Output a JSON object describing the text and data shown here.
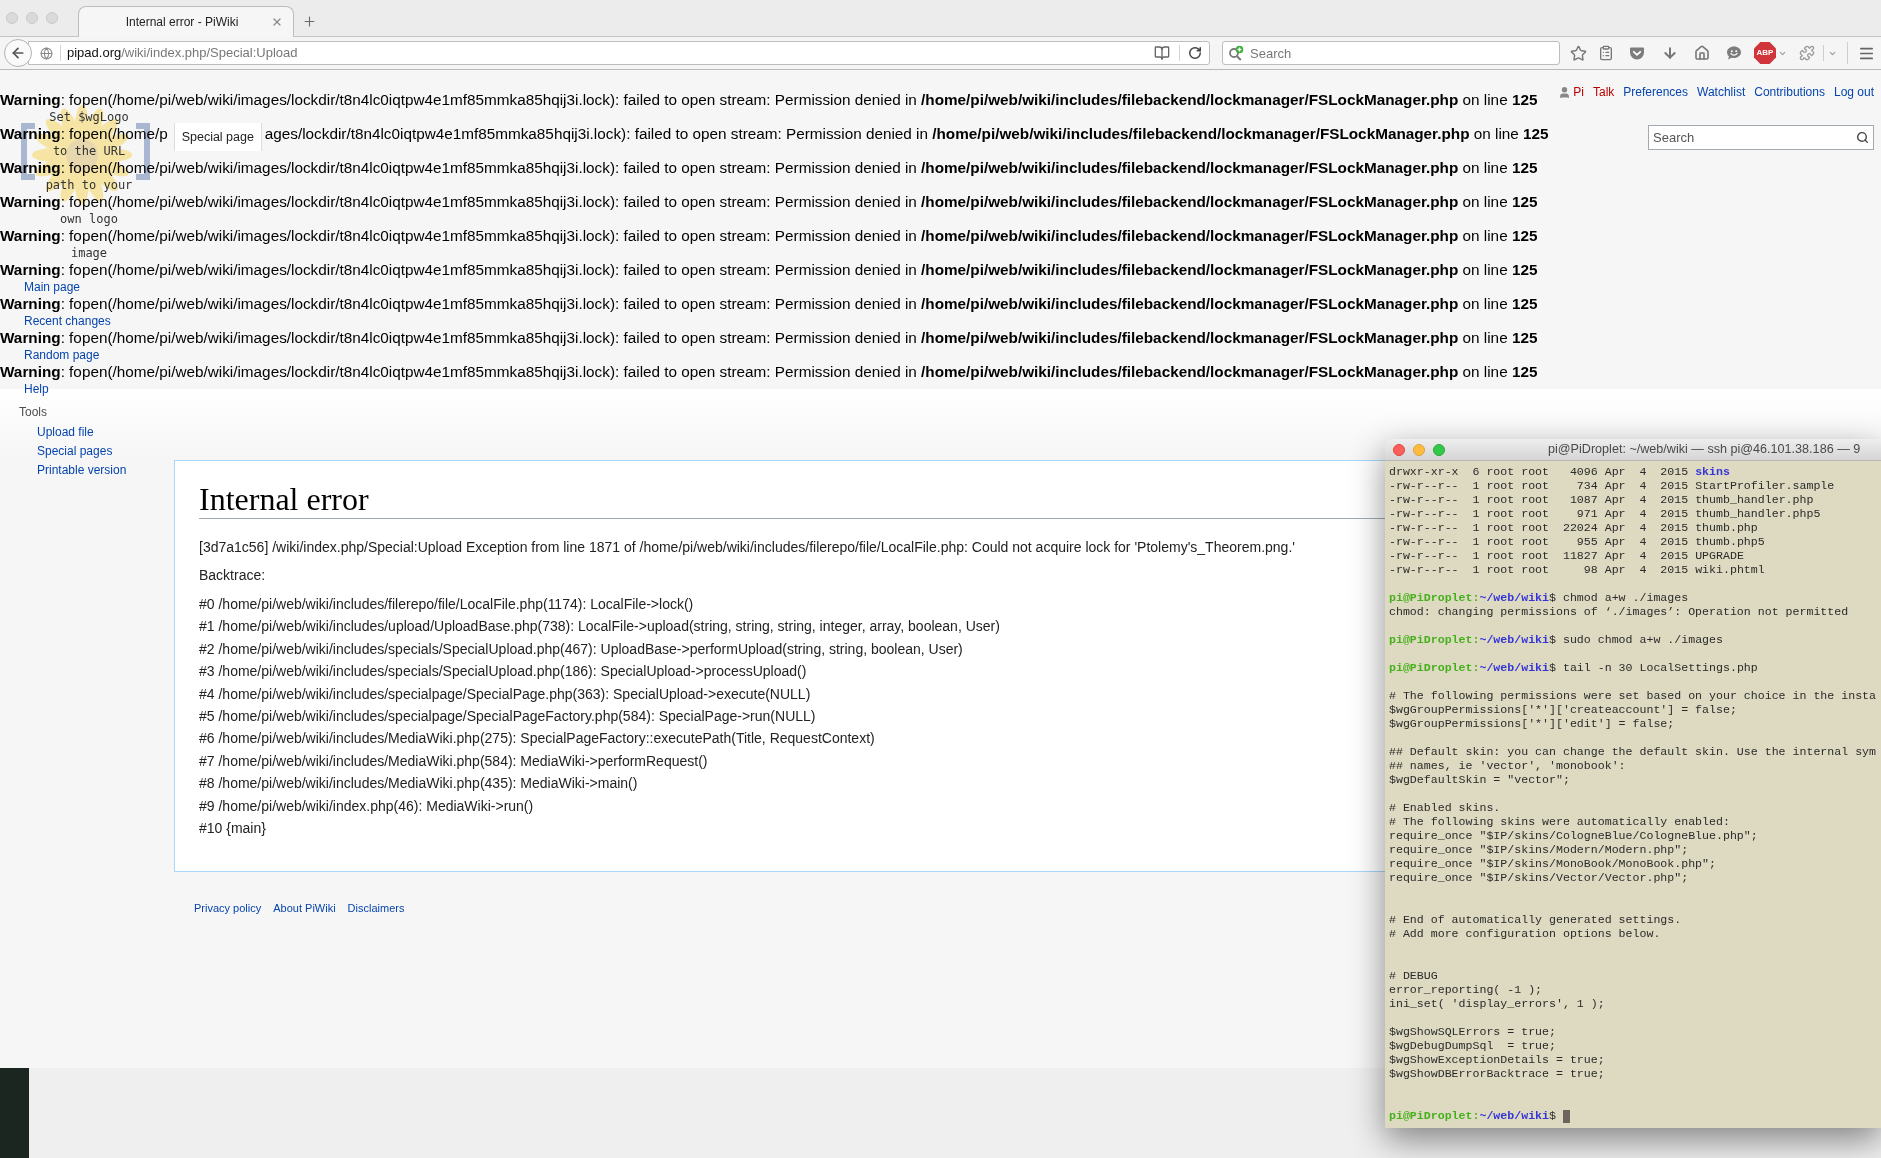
{
  "browser": {
    "tabs": [
      {
        "title": "Internal error - PiWiki",
        "selected": true
      }
    ],
    "url": {
      "domain": "pipad.org",
      "path": "/wiki/index.php/Special:Upload"
    },
    "search": {
      "placeholder": "Search"
    },
    "adblock_label": "ABP"
  },
  "warnings": [
    {
      "parts": [
        "**Warning**: fopen(/home/pi/web/wiki/images/lockdir/t8n4lc0iqtpw4e1mf85mmka85hqij3i.lock): failed to open stream: Permission denied in **/home/pi/web/wiki/includes/filebackend/lockmanager/FSLockManager.php** on line **125**"
      ]
    },
    {
      "parts": [
        "**Warning**: fopen(/home/p",
        "ages/lockdir/t8n4lc0iqtpw4e1mf85mmka85hqij3i.lock): failed to open stream: Permission denied in **/home/pi/web/wiki/includes/filebackend/lockmanager/FSLockManager.php** on line **125**"
      ]
    },
    {
      "parts": [
        "**Warning**: fopen(/home/pi/web/wiki/images/lockdir/t8n4lc0iqtpw4e1mf85mmka85hqij3i.lock): failed to open stream: Permission denied in **/home/pi/web/wiki/includes/filebackend/lockmanager/FSLockManager.php** on line **125**"
      ]
    },
    {
      "parts": [
        "**Warning**: fopen(/home/pi/web/wiki/images/lockdir/t8n4lc0iqtpw4e1mf85mmka85hqij3i.lock): failed to open stream: Permission denied in **/home/pi/web/wiki/includes/filebackend/lockmanager/FSLockManager.php** on line **125**"
      ]
    },
    {
      "parts": [
        "**Warning**: fopen(/home/pi/web/wiki/images/lockdir/t8n4lc0iqtpw4e1mf85mmka85hqij3i.lock): failed to open stream: Permission denied in **/home/pi/web/wiki/includes/filebackend/lockmanager/FSLockManager.php** on line **125**"
      ]
    },
    {
      "parts": [
        "**Warning**: fopen(/home/pi/web/wiki/images/lockdir/t8n4lc0iqtpw4e1mf85mmka85hqij3i.lock): failed to open stream: Permission denied in **/home/pi/web/wiki/includes/filebackend/lockmanager/FSLockManager.php** on line **125**"
      ]
    },
    {
      "parts": [
        "**Warning**: fopen(/home/pi/web/wiki/images/lockdir/t8n4lc0iqtpw4e1mf85mmka85hqij3i.lock): failed to open stream: Permission denied in **/home/pi/web/wiki/includes/filebackend/lockmanager/FSLockManager.php** on line **125**"
      ]
    },
    {
      "parts": [
        "**Warning**: fopen(/home/pi/web/wiki/images/lockdir/t8n4lc0iqtpw4e1mf85mmka85hqij3i.lock): failed to open stream: Permission denied in **/home/pi/web/wiki/includes/filebackend/lockmanager/FSLockManager.php** on line **125**"
      ]
    },
    {
      "parts": [
        "**Warning**: fopen(/home/pi/web/wiki/images/lockdir/t8n4lc0iqtpw4e1mf85mmka85hqij3i.lock): failed to open stream: Permission denied in **/home/pi/web/wiki/includes/filebackend/lockmanager/FSLockManager.php** on line **125**"
      ]
    }
  ],
  "logo": {
    "lines": [
      "Set $wgLogo",
      "to the URL",
      "path to your",
      "own logo",
      "image"
    ]
  },
  "page_tabs": [
    {
      "label": "Special page",
      "selected": true
    }
  ],
  "personal_links": [
    {
      "label": "Pi",
      "kind": "user",
      "exists": false
    },
    {
      "label": "Talk",
      "kind": "link",
      "exists": false
    },
    {
      "label": "Preferences",
      "kind": "link",
      "exists": true
    },
    {
      "label": "Watchlist",
      "kind": "link",
      "exists": true
    },
    {
      "label": "Contributions",
      "kind": "link",
      "exists": true
    },
    {
      "label": "Log out",
      "kind": "link",
      "exists": true
    }
  ],
  "wiki_search": {
    "placeholder": "Search"
  },
  "sidebar": {
    "navigation": [
      "Main page",
      "Recent changes",
      "Random page",
      "Help"
    ],
    "tools_heading": "Tools",
    "tools": [
      "Upload file",
      "Special pages",
      "Printable version"
    ]
  },
  "content": {
    "title": "Internal error",
    "message": "[3d7a1c56] /wiki/index.php/Special:Upload Exception from line 1871 of /home/pi/web/wiki/includes/filerepo/file/LocalFile.php: Could not acquire lock for 'Ptolemy's_Theorem.png.'",
    "backtrace_label": "Backtrace:",
    "backtrace": [
      "#0 /home/pi/web/wiki/includes/filerepo/file/LocalFile.php(1174): LocalFile->lock()",
      "#1 /home/pi/web/wiki/includes/upload/UploadBase.php(738): LocalFile->upload(string, string, string, integer, array, boolean, User)",
      "#2 /home/pi/web/wiki/includes/specials/SpecialUpload.php(467): UploadBase->performUpload(string, string, boolean, User)",
      "#3 /home/pi/web/wiki/includes/specials/SpecialUpload.php(186): SpecialUpload->processUpload()",
      "#4 /home/pi/web/wiki/includes/specialpage/SpecialPage.php(363): SpecialUpload->execute(NULL)",
      "#5 /home/pi/web/wiki/includes/specialpage/SpecialPageFactory.php(584): SpecialPage->run(NULL)",
      "#6 /home/pi/web/wiki/includes/MediaWiki.php(275): SpecialPageFactory::executePath(Title, RequestContext)",
      "#7 /home/pi/web/wiki/includes/MediaWiki.php(584): MediaWiki->performRequest()",
      "#8 /home/pi/web/wiki/includes/MediaWiki.php(435): MediaWiki->main()",
      "#9 /home/pi/web/wiki/index.php(46): MediaWiki->run()",
      "#10 {main}"
    ]
  },
  "footer": {
    "links": [
      "Privacy policy",
      "About PiWiki",
      "Disclaimers"
    ]
  },
  "terminal": {
    "title": "pi@PiDroplet: ~/web/wiki — ssh pi@46.101.38.186 — 9",
    "lines": [
      {
        "kind": "listing",
        "info": "drwxr-xr-x  6 root root   4096 Apr  4  2015",
        "name": "skins",
        "directory": true
      },
      {
        "kind": "listing",
        "info": "-rw-r--r--  1 root root    734 Apr  4  2015",
        "name": "StartProfiler.sample",
        "directory": false
      },
      {
        "kind": "listing",
        "info": "-rw-r--r--  1 root root   1087 Apr  4  2015",
        "name": "thumb_handler.php",
        "directory": false
      },
      {
        "kind": "listing",
        "info": "-rw-r--r--  1 root root    971 Apr  4  2015",
        "name": "thumb_handler.php5",
        "directory": false
      },
      {
        "kind": "listing",
        "info": "-rw-r--r--  1 root root  22024 Apr  4  2015",
        "name": "thumb.php",
        "directory": false
      },
      {
        "kind": "listing",
        "info": "-rw-r--r--  1 root root    955 Apr  4  2015",
        "name": "thumb.php5",
        "directory": false
      },
      {
        "kind": "listing",
        "info": "-rw-r--r--  1 root root  11827 Apr  4  2015",
        "name": "UPGRADE",
        "directory": false
      },
      {
        "kind": "listing",
        "info": "-rw-r--r--  1 root root     98 Apr  4  2015",
        "name": "wiki.phtml",
        "directory": false
      },
      {
        "kind": "blank"
      },
      {
        "kind": "prompt",
        "user": "pi@PiDroplet:",
        "path": "~/web/wiki",
        "symbol": "$",
        "command": "chmod a+w ./images",
        "cursor": false
      },
      {
        "kind": "output",
        "text": "chmod: changing permissions of ‘./images’: Operation not permitted"
      },
      {
        "kind": "blank"
      },
      {
        "kind": "prompt",
        "user": "pi@PiDroplet:",
        "path": "~/web/wiki",
        "symbol": "$",
        "command": "sudo chmod a+w ./images",
        "cursor": false
      },
      {
        "kind": "blank"
      },
      {
        "kind": "prompt",
        "user": "pi@PiDroplet:",
        "path": "~/web/wiki",
        "symbol": "$",
        "command": "tail -n 30 LocalSettings.php",
        "cursor": false
      },
      {
        "kind": "blank"
      },
      {
        "kind": "output",
        "text": "# The following permissions were set based on your choice in the insta"
      },
      {
        "kind": "output",
        "text": "$wgGroupPermissions['*']['createaccount'] = false;"
      },
      {
        "kind": "output",
        "text": "$wgGroupPermissions['*']['edit'] = false;"
      },
      {
        "kind": "blank"
      },
      {
        "kind": "output",
        "text": "## Default skin: you can change the default skin. Use the internal sym"
      },
      {
        "kind": "output",
        "text": "## names, ie 'vector', 'monobook':"
      },
      {
        "kind": "output",
        "text": "$wgDefaultSkin = \"vector\";"
      },
      {
        "kind": "blank"
      },
      {
        "kind": "output",
        "text": "# Enabled skins."
      },
      {
        "kind": "output",
        "text": "# The following skins were automatically enabled:"
      },
      {
        "kind": "output",
        "text": "require_once \"$IP/skins/CologneBlue/CologneBlue.php\";"
      },
      {
        "kind": "output",
        "text": "require_once \"$IP/skins/Modern/Modern.php\";"
      },
      {
        "kind": "output",
        "text": "require_once \"$IP/skins/MonoBook/MonoBook.php\";"
      },
      {
        "kind": "output",
        "text": "require_once \"$IP/skins/Vector/Vector.php\";"
      },
      {
        "kind": "blank"
      },
      {
        "kind": "blank"
      },
      {
        "kind": "output",
        "text": "# End of automatically generated settings."
      },
      {
        "kind": "output",
        "text": "# Add more configuration options below."
      },
      {
        "kind": "blank"
      },
      {
        "kind": "blank"
      },
      {
        "kind": "output",
        "text": "# DEBUG"
      },
      {
        "kind": "output",
        "text": "error_reporting( -1 );"
      },
      {
        "kind": "output",
        "text": "ini_set( 'display_errors', 1 );"
      },
      {
        "kind": "blank"
      },
      {
        "kind": "output",
        "text": "$wgShowSQLErrors = true;"
      },
      {
        "kind": "output",
        "text": "$wgDebugDumpSql  = true;"
      },
      {
        "kind": "output",
        "text": "$wgShowExceptionDetails = true;"
      },
      {
        "kind": "output",
        "text": "$wgShowDBErrorBacktrace = true;"
      },
      {
        "kind": "blank"
      },
      {
        "kind": "blank"
      },
      {
        "kind": "prompt",
        "user": "pi@PiDroplet:",
        "path": "~/web/wiki",
        "symbol": "$",
        "cursor": true
      }
    ]
  }
}
